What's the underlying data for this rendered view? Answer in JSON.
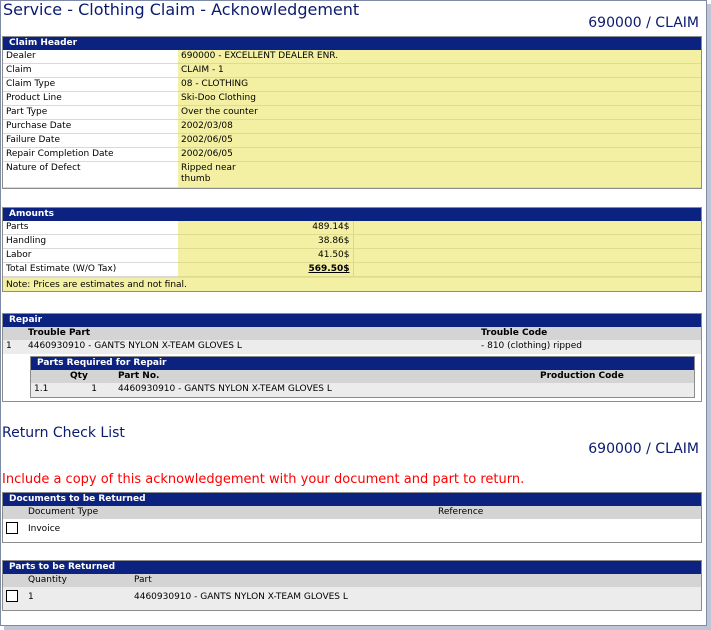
{
  "page_title": "Service - Clothing Claim - Acknowledgement",
  "claim_ref": "690000 / CLAIM",
  "claim_header": {
    "title": "Claim Header",
    "rows": [
      {
        "label": "Dealer",
        "value": "690000 - EXCELLENT DEALER ENR."
      },
      {
        "label": "Claim",
        "value": "CLAIM - 1"
      },
      {
        "label": "Claim Type",
        "value": "08 - CLOTHING"
      },
      {
        "label": "Product Line",
        "value": "Ski-Doo Clothing"
      },
      {
        "label": "Part Type",
        "value": "Over the counter"
      },
      {
        "label": "Purchase Date",
        "value": "2002/03/08"
      },
      {
        "label": "Failure Date",
        "value": "2002/06/05"
      },
      {
        "label": "Repair Completion Date",
        "value": "2002/06/05"
      }
    ],
    "defect_label": "Nature of Defect",
    "defect_line1": "Ripped near",
    "defect_line2": "thumb"
  },
  "amounts": {
    "title": "Amounts",
    "rows": [
      {
        "label": "Parts",
        "value": "489.14$"
      },
      {
        "label": "Handling",
        "value": "38.86$"
      },
      {
        "label": "Labor",
        "value": "41.50$"
      }
    ],
    "total_label": "Total Estimate (W/O Tax)",
    "total_value": "569.50$",
    "note": "Note: Prices are estimates and not final."
  },
  "repair": {
    "title": "Repair",
    "col_trouble_part": "Trouble Part",
    "col_trouble_code": "Trouble Code",
    "row_index": "1",
    "row_part": "4460930910 - GANTS NYLON X-TEAM GLOVES L",
    "row_code": "-   810 (clothing) ripped",
    "parts_required": {
      "title": "Parts Required for Repair",
      "col_qty": "Qty",
      "col_part_no": "Part No.",
      "col_production_code": "Production Code",
      "row_index": "1.1",
      "row_qty": "1",
      "row_part_no": "4460930910 - GANTS NYLON X-TEAM GLOVES L",
      "row_production_code": ""
    }
  },
  "return_check_list_title": "Return Check List",
  "warning": "Include a copy of this acknowledgement with your document and part to return.",
  "documents": {
    "title": "Documents to be Returned",
    "col_document_type": "Document Type",
    "col_reference": "Reference",
    "row_document_type": "Invoice",
    "row_reference": ""
  },
  "parts_returned": {
    "title": "Parts to be Returned",
    "col_quantity": "Quantity",
    "col_part": "Part",
    "row_quantity": "1",
    "row_part": "4460930910 - GANTS NYLON X-TEAM GLOVES L"
  },
  "colors": {
    "header_bar": "#0c2280",
    "value_bg": "#f4f0a3",
    "title_text": "#0a1a6e",
    "warning_text": "#ff0000"
  }
}
